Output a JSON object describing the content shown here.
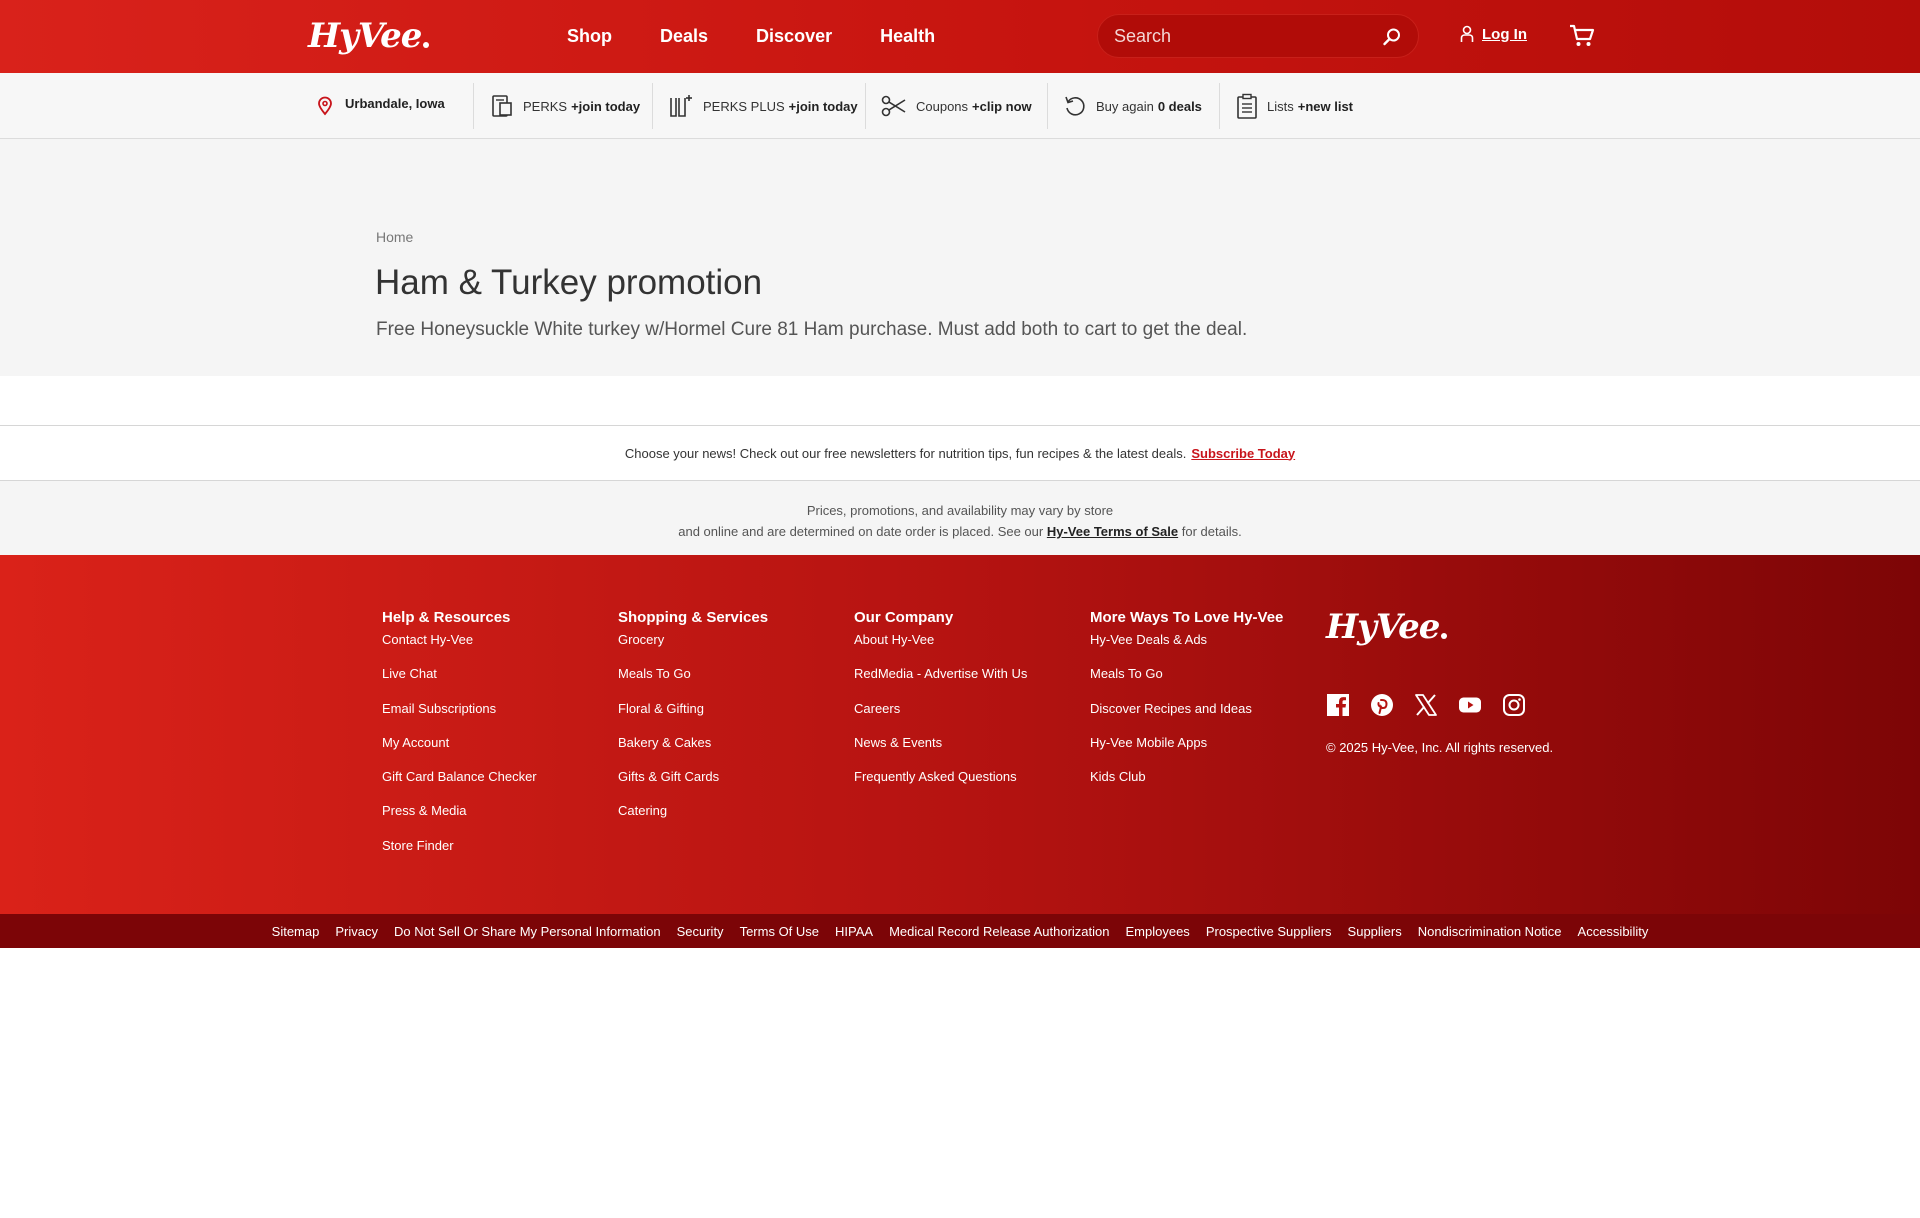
{
  "header": {
    "logo_text": "HyVee",
    "nav": [
      "Shop",
      "Deals",
      "Discover",
      "Health"
    ],
    "search_placeholder": "Search",
    "login_label": "Log In",
    "colors": {
      "brand_red": "#c6140f",
      "dark_red": "#7c0507"
    }
  },
  "subnav": {
    "location": "Urbandale, Iowa",
    "perks": {
      "label": "PERKS",
      "action": "+join today"
    },
    "perks_plus": {
      "label": "PERKS PLUS",
      "action": "+join today"
    },
    "coupons": {
      "label": "Coupons",
      "action": "+clip now"
    },
    "buy_again": {
      "label": "Buy again",
      "action": "0 deals"
    },
    "lists": {
      "label": "Lists",
      "action": "+new list"
    }
  },
  "hero": {
    "breadcrumb": "Home",
    "title": "Ham & Turkey promotion",
    "description": "Free Honeysuckle White turkey w/Hormel Cure 81 Ham purchase. Must add both to cart to get the deal."
  },
  "newsletter": {
    "text": "Choose your news! Check out our free newsletters for nutrition tips, fun recipes & the latest deals.",
    "link": "Subscribe Today"
  },
  "disclaimer": {
    "line1": "Prices, promotions, and availability may vary by store",
    "line2_pre": "and online and are determined on date order is placed. See our",
    "link": "Hy-Vee Terms of Sale",
    "line2_post": "for details."
  },
  "footer": {
    "columns": [
      {
        "title": "Help & Resources",
        "links": [
          "Contact Hy-Vee",
          "Live Chat",
          "Email Subscriptions",
          "My Account",
          "Gift Card Balance Checker",
          "Press & Media",
          "Store Finder"
        ]
      },
      {
        "title": "Shopping & Services",
        "links": [
          "Grocery",
          "Meals To Go",
          "Floral & Gifting",
          "Bakery & Cakes",
          "Gifts & Gift Cards",
          "Catering"
        ]
      },
      {
        "title": "Our Company",
        "links": [
          "About Hy-Vee",
          "RedMedia - Advertise With Us",
          "Careers",
          "News & Events",
          "Frequently Asked Questions"
        ]
      },
      {
        "title": "More Ways To Love Hy-Vee",
        "links": [
          "Hy-Vee Deals & Ads",
          "Meals To Go",
          "Discover Recipes and Ideas",
          "Hy-Vee Mobile Apps",
          "Kids Club"
        ]
      }
    ],
    "logo_text": "HyVee",
    "socials": [
      "facebook-icon",
      "pinterest-icon",
      "x-icon",
      "youtube-icon",
      "instagram-icon"
    ],
    "copyright": "© 2025 Hy-Vee, Inc. All rights reserved."
  },
  "bottom_links": [
    "Sitemap",
    "Privacy",
    "Do Not Sell Or Share My Personal Information",
    "Security",
    "Terms Of Use",
    "HIPAA",
    "Medical Record Release Authorization",
    "Employees",
    "Prospective Suppliers",
    "Suppliers",
    "Nondiscrimination Notice",
    "Accessibility"
  ]
}
